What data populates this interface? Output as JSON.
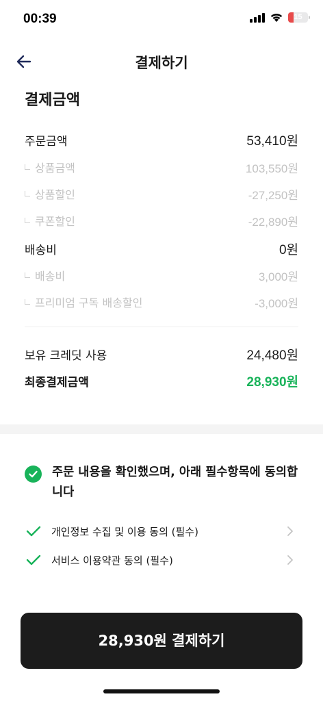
{
  "status_bar": {
    "time": "00:39",
    "battery": "15"
  },
  "nav": {
    "title": "결제하기"
  },
  "section_title": "결제금액",
  "breakdown": [
    {
      "label": "주문금액",
      "value": "53,410원",
      "sub": false
    },
    {
      "label": "상품금액",
      "value": "103,550원",
      "sub": true
    },
    {
      "label": "상품할인",
      "value": "-27,250원",
      "sub": true
    },
    {
      "label": "쿠폰할인",
      "value": "-22,890원",
      "sub": true
    },
    {
      "label": "배송비",
      "value": "0원",
      "sub": false
    },
    {
      "label": "배송비",
      "value": "3,000원",
      "sub": true
    },
    {
      "label": "프리미엄 구독 배송할인",
      "value": "-3,000원",
      "sub": true
    }
  ],
  "credit": {
    "label": "보유 크레딧 사용",
    "value": "24,480원"
  },
  "final": {
    "label": "최종결제금액",
    "value": "28,930원"
  },
  "agreement": {
    "all_label": "주문 내용을 확인했으며, 아래 필수항목에 동의합니다",
    "terms": [
      {
        "label": "개인정보 수집 및 이용 동의 (필수)"
      },
      {
        "label": "서비스 이용약관 동의 (필수)"
      }
    ]
  },
  "pay_button": {
    "label": "28,930원 결제하기"
  },
  "colors": {
    "accent": "#19b35a",
    "button_bg": "#1c1c1c",
    "muted": "#c2c2c2"
  }
}
